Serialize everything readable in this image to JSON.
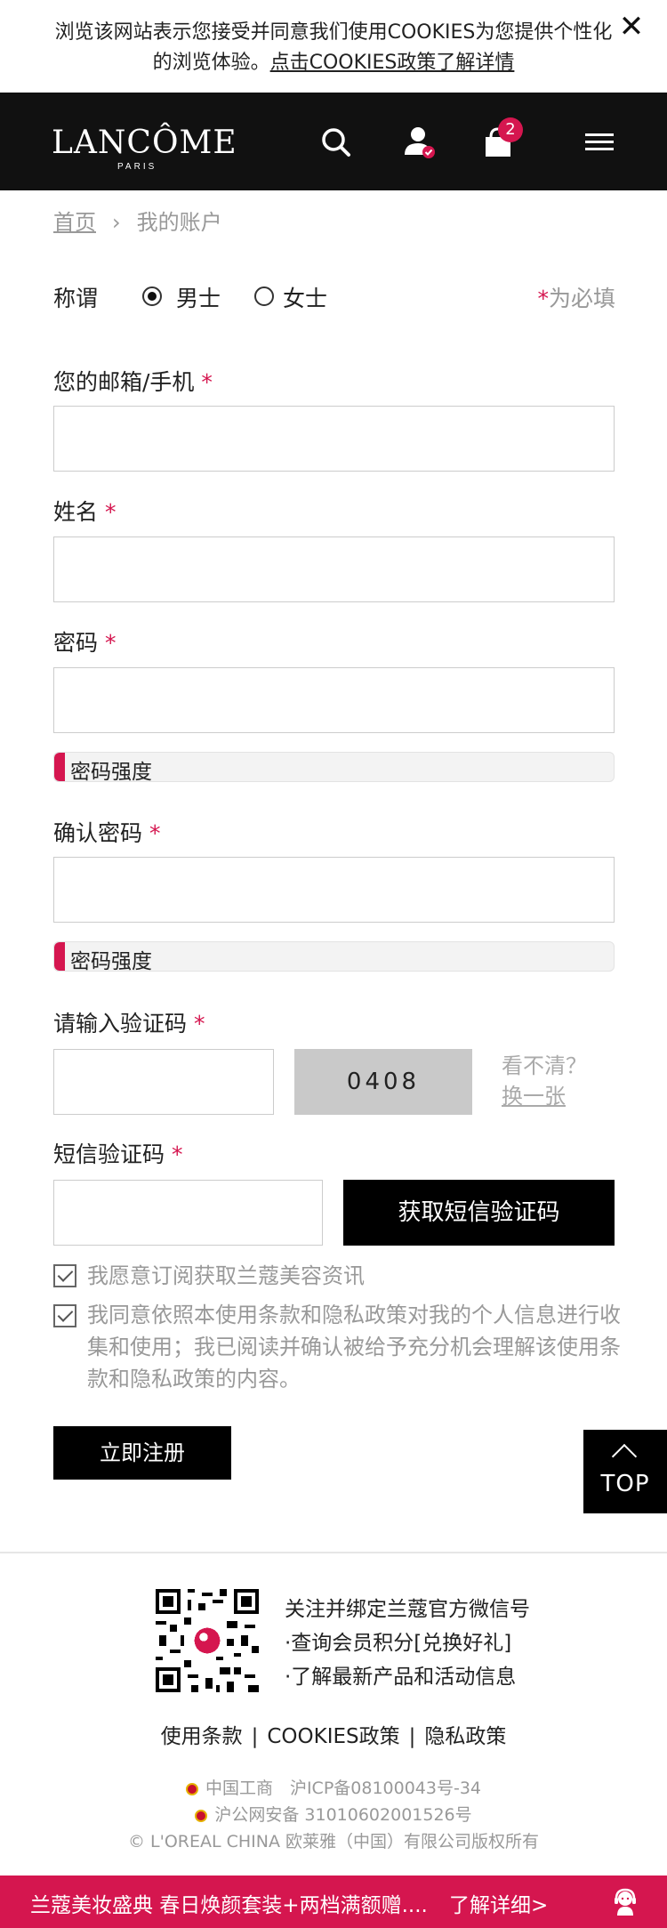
{
  "cookie": {
    "text_pre": "浏览该网站表示您接受并同意我们使用COOKIES为您提供个性化的浏览体验。",
    "link": "点击COOKIES政策了解详情",
    "close_icon": "close-icon"
  },
  "header": {
    "logo": "LANCÔME",
    "logo_sub": "PARIS",
    "cart_count": "2",
    "icons": [
      "search-icon",
      "account-icon",
      "cart-icon",
      "menu-icon"
    ]
  },
  "breadcrumb": {
    "home": "首页",
    "separator": "›",
    "current": "我的账户"
  },
  "form": {
    "salutation": {
      "label": "称谓",
      "options": [
        "男士",
        "女士"
      ],
      "selected": "男士"
    },
    "required_star": "*",
    "required_note": "为必填",
    "email_label": "您的邮箱/手机",
    "name_label": "姓名",
    "password_label": "密码",
    "strength_label": "密码强度",
    "confirm_label": "确认密码",
    "captcha_label": "请输入验证码",
    "captcha_code": "0408",
    "captcha_cant_see": "看不清？",
    "captcha_change": "换一张",
    "sms_label": "短信验证码",
    "sms_button": "获取短信验证码",
    "subscribe_text": "我愿意订阅获取兰蔻美容资讯",
    "consent_text": "我同意依照本使用条款和隐私政策对我的个人信息进行收集和使用；我已阅读并确认被给予充分机会理解该使用条款和隐私政策的内容。",
    "register_button": "立即注册"
  },
  "top_button": "TOP",
  "footer": {
    "wechat_title": "关注并绑定兰蔻官方微信号",
    "wechat_line1": "·查询会员积分[兑换好礼]",
    "wechat_line2": "·了解最新产品和活动信息",
    "links": [
      "使用条款",
      "COOKIES政策",
      "隐私政策"
    ],
    "link_divider": "|",
    "legal1": "中国工商　沪ICP备08100043号-34",
    "legal2": "沪公网安备 310106020015 26号",
    "legal2_exact": "沪公网安备 31010602001526号",
    "copyright": "© L'OREAL CHINA 欧莱雅（中国）有限公司版权所有"
  },
  "promo": {
    "text": "兰蔻美妆盛典 春日焕颜套装+两档满额赠....",
    "more": "了解详细>",
    "icon": "customer-service-icon"
  },
  "colors": {
    "accent": "#d5164f",
    "header_bg": "#111111",
    "button_bg": "#000000",
    "muted_text": "#999999"
  }
}
